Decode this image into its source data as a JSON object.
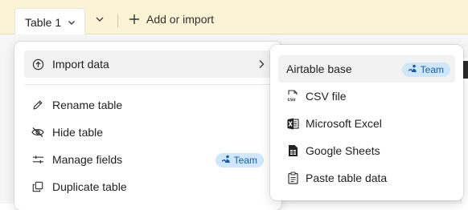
{
  "toolbar": {
    "table_tab_label": "Table 1",
    "add_or_import_label": "Add or import"
  },
  "table_menu": {
    "items": [
      {
        "label": "Import data",
        "icon": "arrow-up-circle-icon",
        "has_submenu": true
      },
      {
        "label": "Rename table",
        "icon": "pencil-icon"
      },
      {
        "label": "Hide table",
        "icon": "eye-slash-icon"
      },
      {
        "label": "Manage fields",
        "icon": "sliders-icon",
        "badge": "Team"
      },
      {
        "label": "Duplicate table",
        "icon": "copy-icon"
      }
    ]
  },
  "import_submenu": {
    "items": [
      {
        "label": "Airtable base",
        "badge": "Team"
      },
      {
        "label": "CSV file",
        "icon": "csv-file-icon"
      },
      {
        "label": "Microsoft Excel",
        "icon": "excel-icon"
      },
      {
        "label": "Google Sheets",
        "icon": "google-sheets-icon"
      },
      {
        "label": "Paste table data",
        "icon": "clipboard-icon"
      }
    ]
  },
  "colors": {
    "topbar_bg": "#fbf3d5",
    "badge_bg": "#cfe6fb",
    "badge_text": "#1b5c9e",
    "hover_bg": "#f2f2f2"
  }
}
